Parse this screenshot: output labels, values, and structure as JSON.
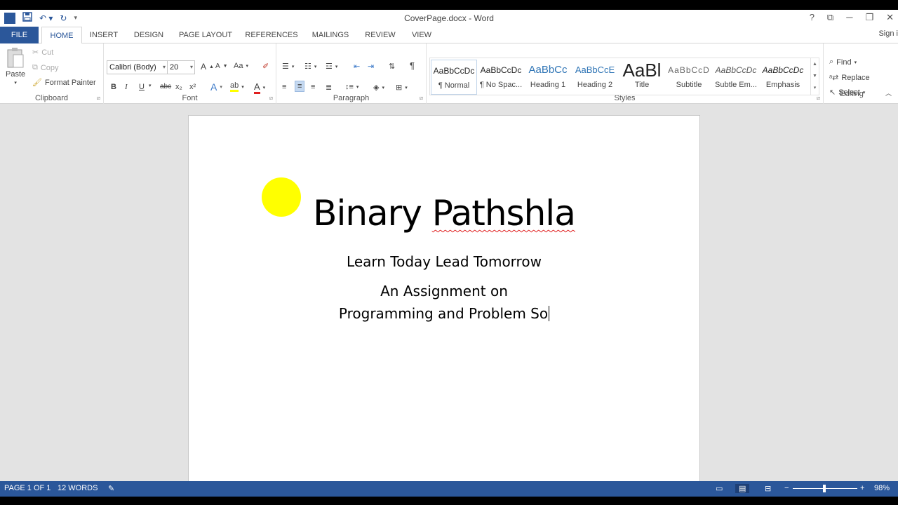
{
  "window": {
    "title": "CoverPage.docx - Word",
    "help": "?",
    "signin": "Sign i"
  },
  "qat": {
    "app_icon": "W",
    "save_icon": "save-icon",
    "undo_icon": "undo-icon",
    "redo_icon": "redo-icon"
  },
  "tabs": [
    "FILE",
    "HOME",
    "INSERT",
    "DESIGN",
    "PAGE LAYOUT",
    "REFERENCES",
    "MAILINGS",
    "REVIEW",
    "VIEW"
  ],
  "clipboard": {
    "paste": "Paste",
    "cut": "Cut",
    "copy": "Copy",
    "format_painter": "Format Painter",
    "label": "Clipboard"
  },
  "font": {
    "family": "Calibri (Body)",
    "size": "20",
    "case": "Aa",
    "bold": "B",
    "italic": "I",
    "underline": "U",
    "strike": "abc",
    "sub": "x₂",
    "sup": "x²",
    "color_letter": "A",
    "grow": "A",
    "shrink": "A",
    "label": "Font"
  },
  "paragraph": {
    "label": "Paragraph",
    "pilcrow": "¶"
  },
  "styles": {
    "items": [
      {
        "preview": "AaBbCcDc",
        "name": "¶ Normal"
      },
      {
        "preview": "AaBbCcDc",
        "name": "¶ No Spac..."
      },
      {
        "preview": "AaBbCc",
        "name": "Heading 1"
      },
      {
        "preview": "AaBbCcE",
        "name": "Heading 2"
      },
      {
        "preview": "AaBl",
        "name": "Title"
      },
      {
        "preview": "AaBbCcD",
        "name": "Subtitle"
      },
      {
        "preview": "AaBbCcDc",
        "name": "Subtle Em..."
      },
      {
        "preview": "AaBbCcDc",
        "name": "Emphasis"
      }
    ],
    "label": "Styles"
  },
  "editing": {
    "find": "Find",
    "replace": "Replace",
    "select": "Select",
    "label": "Editing"
  },
  "document": {
    "title_part1": "Binary ",
    "title_part2": "Pathshla",
    "tagline": "Learn Today Lead Tomorrow",
    "line1": "An Assignment on",
    "line2": "Programming and Problem So"
  },
  "status": {
    "page": "PAGE 1 OF 1",
    "words": "12 WORDS",
    "zoom_minus": "−",
    "zoom_plus": "+",
    "zoom": "98%"
  },
  "colors": {
    "accent": "#2b579a",
    "highlight_dot": "#ffff00"
  }
}
